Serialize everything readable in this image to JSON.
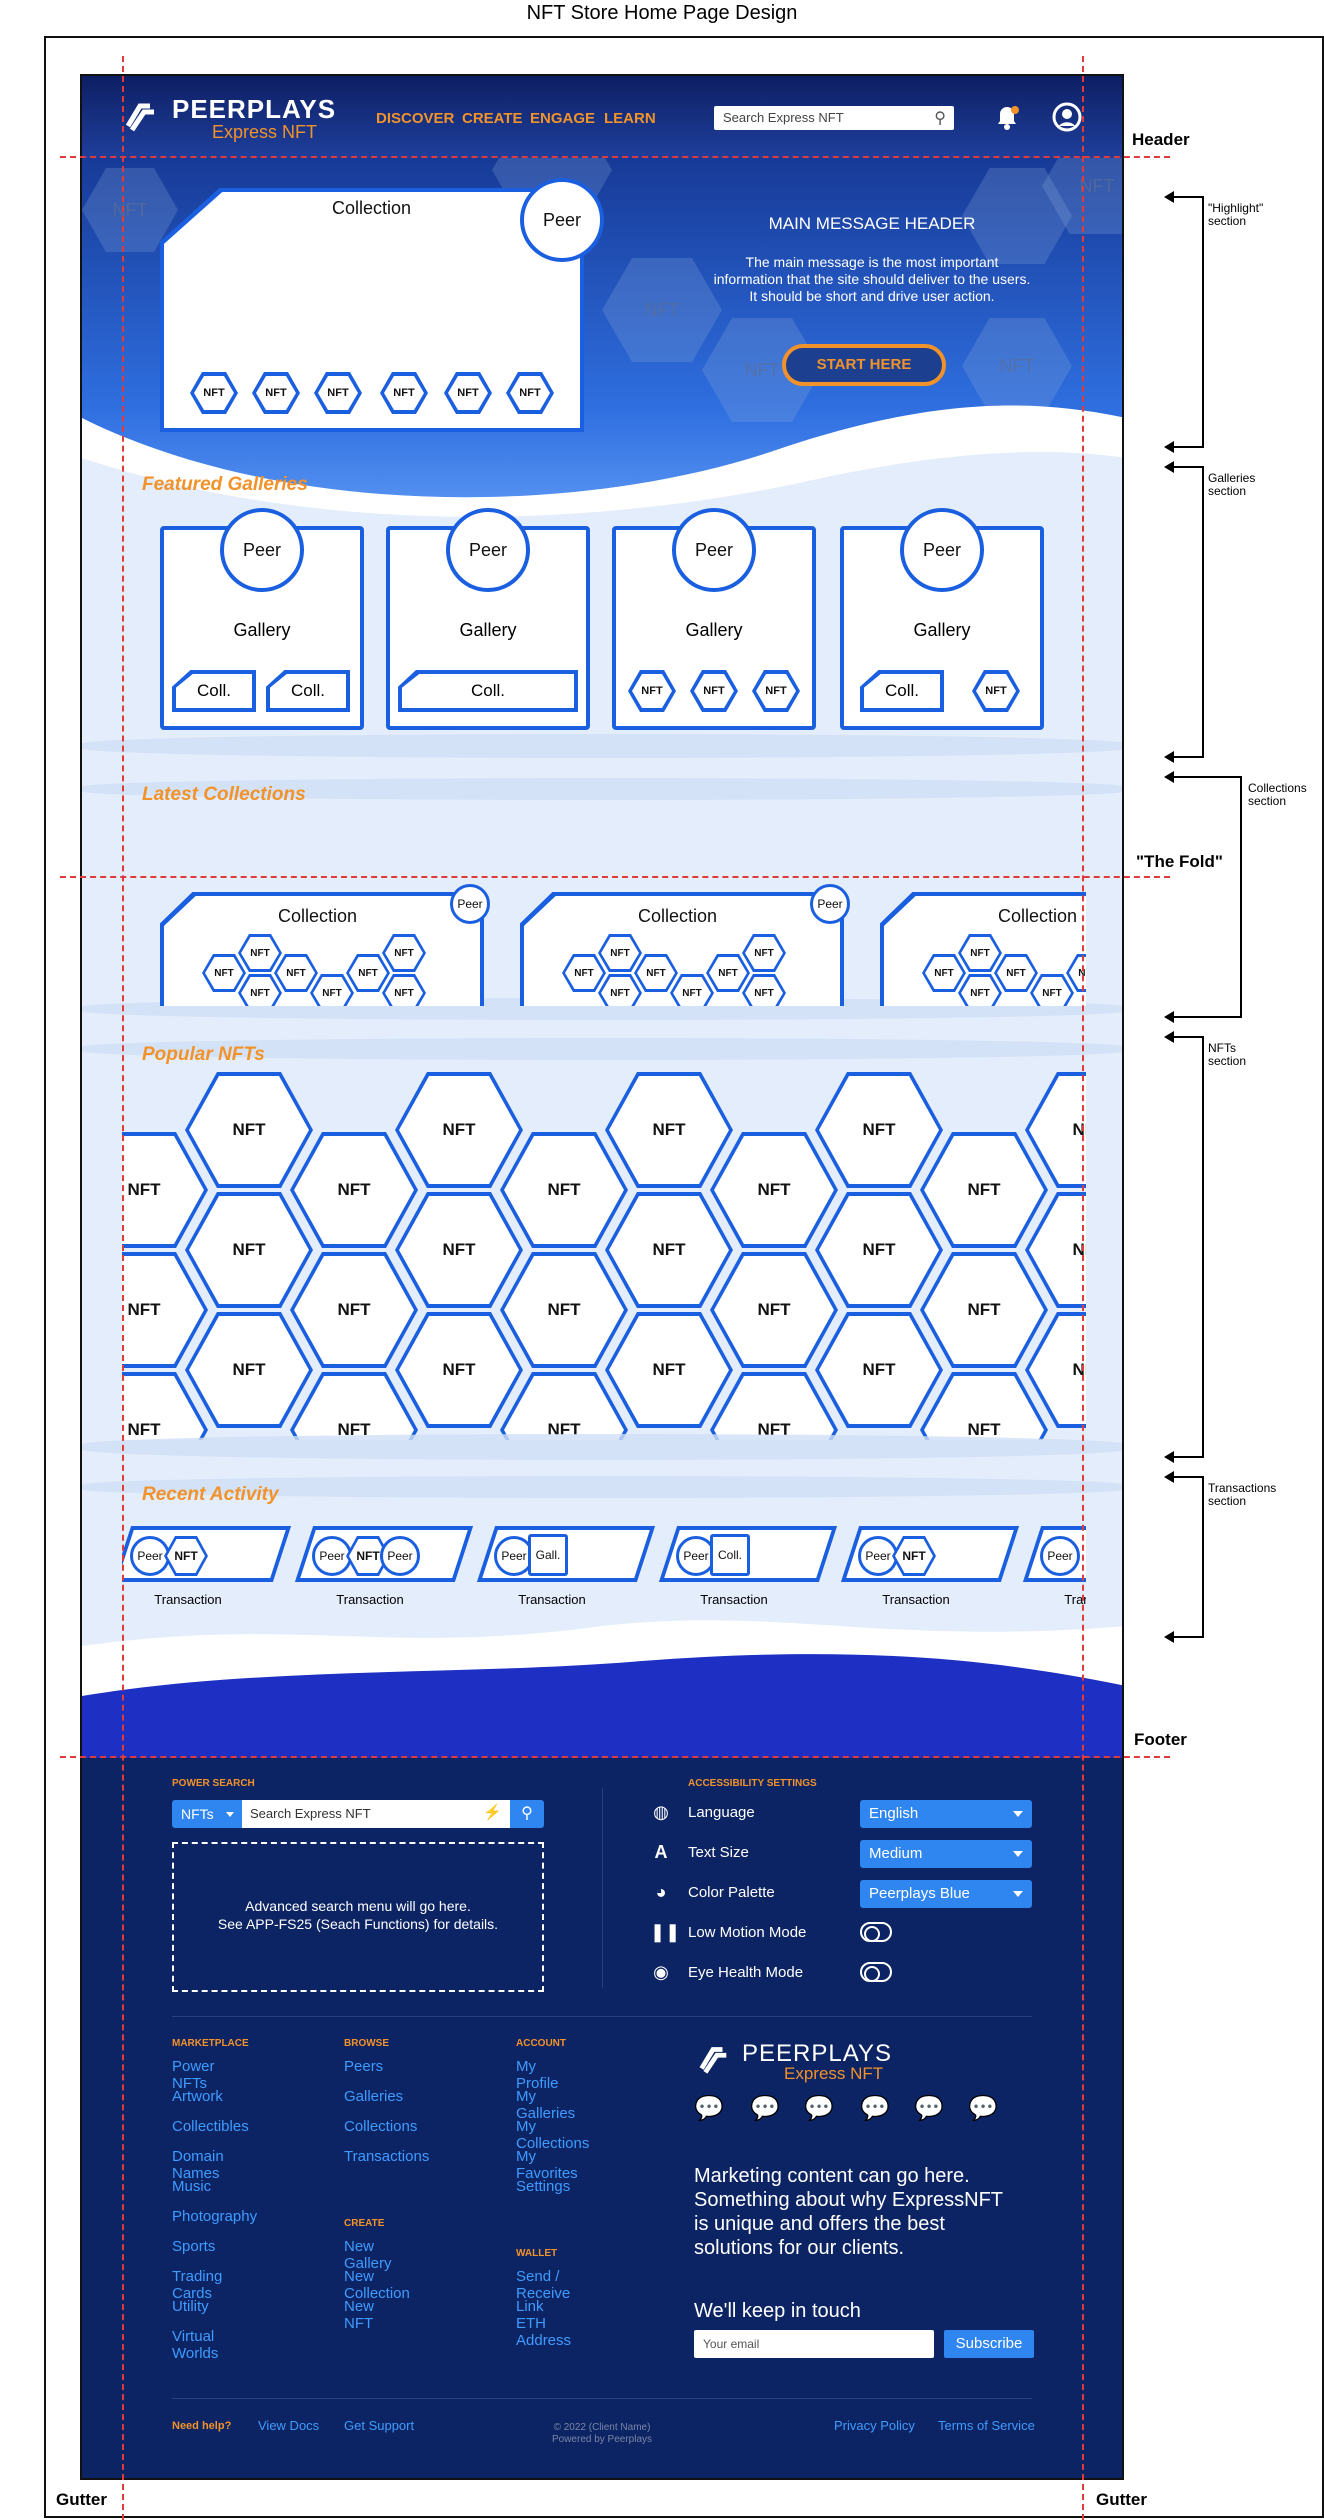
{
  "page_title": "NFT Store Home Page Design",
  "header": {
    "logo_main": "PEERPLAYS",
    "logo_sub": "Express NFT",
    "nav": [
      "DISCOVER",
      "CREATE",
      "ENGAGE",
      "LEARN"
    ],
    "search_placeholder": "Search Express NFT"
  },
  "hero": {
    "collection_label": "Collection",
    "peer_label": "Peer",
    "nft_label": "NFT",
    "main_header": "MAIN MESSAGE HEADER",
    "main_text_1": "The main message is the most important",
    "main_text_2": "information that the site should deliver to the users.",
    "main_text_3": "It should be short and drive user action.",
    "cta": "START HERE",
    "bg_hex_label": "NFT"
  },
  "galleries": {
    "title": "Featured Galleries",
    "peer_label": "Peer",
    "gallery_label": "Gallery",
    "coll_label": "Coll.",
    "nft_label": "NFT"
  },
  "collections": {
    "title": "Latest Collections",
    "collection_label": "Collection",
    "peer_label": "Peer",
    "nft_label": "NFT"
  },
  "nfts": {
    "title": "Popular NFTs",
    "nft_label": "NFT"
  },
  "activity": {
    "title": "Recent Activity",
    "transaction_label": "Transaction",
    "peer_label": "Peer",
    "nft_label": "NFT",
    "gall_label": "Gall.",
    "coll_label": "Coll."
  },
  "annotations": {
    "header": "Header",
    "highlight": "\"Highlight\" section",
    "galleries": "Galleries section",
    "collections": "Collections section",
    "fold": "\"The Fold\"",
    "nfts": "NFTs section",
    "transactions": "Transactions section",
    "footer": "Footer",
    "gutter": "Gutter"
  },
  "footer": {
    "power_search_title": "POWER SEARCH",
    "search_type": "NFTs",
    "search_placeholder": "Search Express NFT",
    "adv_line1": "Advanced search menu will go here.",
    "adv_line2": "See APP-FS25 (Seach Functions) for details.",
    "accessibility_title": "ACCESSIBILITY SETTINGS",
    "language_label": "Language",
    "language_value": "English",
    "text_size_label": "Text Size",
    "text_size_value": "Medium",
    "palette_label": "Color Palette",
    "palette_value": "Peerplays Blue",
    "low_motion_label": "Low Motion Mode",
    "eye_health_label": "Eye Health Mode",
    "marketplace_title": "MARKETPLACE",
    "marketplace": [
      "Power NFTs",
      "Artwork",
      "Collectibles",
      "Domain Names",
      "Music",
      "Photography",
      "Sports",
      "Trading Cards",
      "Utility",
      "Virtual Worlds"
    ],
    "browse_title": "BROWSE",
    "browse": [
      "Peers",
      "Galleries",
      "Collections",
      "Transactions"
    ],
    "create_title": "CREATE",
    "create": [
      "New Gallery",
      "New Collection",
      "New NFT"
    ],
    "account_title": "ACCOUNT",
    "account": [
      "My Profile",
      "My Galleries",
      "My Collections",
      "My Favorites",
      "Settings"
    ],
    "wallet_title": "WALLET",
    "wallet": [
      "Send / Receive",
      "Link ETH Address"
    ],
    "logo_main": "PEERPLAYS",
    "logo_sub": "Express NFT",
    "marketing_1": "Marketing content can go here.",
    "marketing_2": "Something about why ExpressNFT",
    "marketing_3": "is unique and offers the best",
    "marketing_4": "solutions for our clients.",
    "keep_touch": "We'll keep in touch",
    "email_placeholder": "Your email",
    "subscribe": "Subscribe",
    "need_help": "Need help?",
    "view_docs": "View Docs",
    "get_support": "Get Support",
    "copyright": "© 2022 (Client Name)",
    "powered": "Powered by Peerplays",
    "privacy": "Privacy Policy",
    "terms": "Terms of Service"
  },
  "colors": {
    "brand_blue": "#1a5fe0",
    "accent_orange": "#f2922a",
    "footer_navy": "#0c2463"
  }
}
